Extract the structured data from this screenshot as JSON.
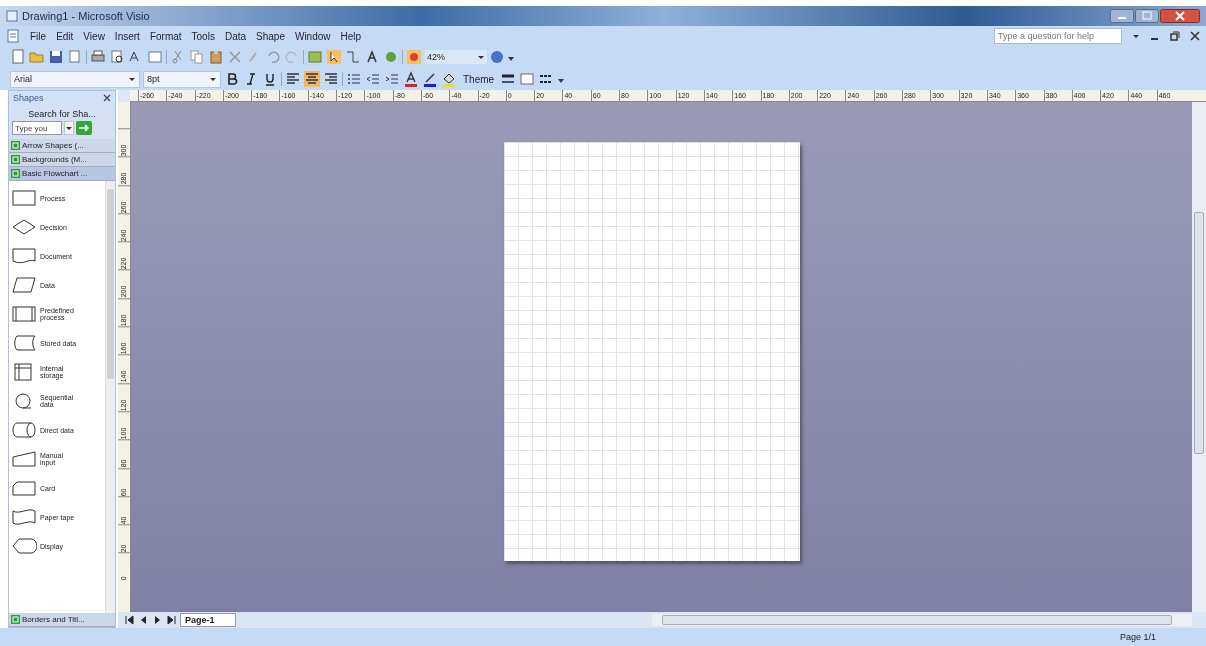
{
  "window": {
    "title": "Drawing1 - Microsoft Visio"
  },
  "menu": [
    "File",
    "Edit",
    "View",
    "Insert",
    "Format",
    "Tools",
    "Data",
    "Shape",
    "Window",
    "Help"
  ],
  "help_box": {
    "placeholder": "Type a question for help"
  },
  "toolbar": {
    "zoom": "42%"
  },
  "formatting": {
    "font": "Arial",
    "size": "8pt",
    "theme": "Theme",
    "bold": false,
    "italic": false,
    "underline": false,
    "align_left": false,
    "align_center": true,
    "align_right": false
  },
  "shapes_panel": {
    "title": "Shapes",
    "search_label": "Search for Sha...",
    "search": {
      "placeholder": "Type you"
    },
    "stencils_top": [
      {
        "label": "Arrow Shapes (..."
      },
      {
        "label": "Backgrounds (M..."
      },
      {
        "label": "Basic Flowchart ...",
        "selected": true
      }
    ],
    "shapes": [
      {
        "kind": "process",
        "label": "Process"
      },
      {
        "kind": "decision",
        "label": "Decision"
      },
      {
        "kind": "document",
        "label": "Document"
      },
      {
        "kind": "data",
        "label": "Data"
      },
      {
        "kind": "predefined",
        "label": "Predefined process"
      },
      {
        "kind": "stored",
        "label": "Stored data"
      },
      {
        "kind": "internal",
        "label": "Internal storage"
      },
      {
        "kind": "sequential",
        "label": "Sequential data"
      },
      {
        "kind": "direct",
        "label": "Direct data"
      },
      {
        "kind": "manual",
        "label": "Manual input"
      },
      {
        "kind": "card",
        "label": "Card"
      },
      {
        "kind": "tape",
        "label": "Paper tape"
      },
      {
        "kind": "display",
        "label": "Display"
      }
    ],
    "stencils_bottom": [
      {
        "label": "Borders and Titl..."
      }
    ]
  },
  "ruler_h": [
    "-260",
    "-240",
    "-220",
    "-200",
    "-180",
    "-160",
    "-140",
    "-120",
    "-100",
    "-80",
    "-60",
    "-40",
    "-20",
    "0",
    "20",
    "40",
    "60",
    "80",
    "100",
    "120",
    "140",
    "160",
    "180",
    "200",
    "220",
    "240",
    "260",
    "280",
    "300",
    "320",
    "340",
    "360",
    "380",
    "400",
    "420",
    "440",
    "460"
  ],
  "ruler_v": [
    "300",
    "280",
    "260",
    "240",
    "220",
    "200",
    "180",
    "160",
    "140",
    "120",
    "100",
    "80",
    "60",
    "40",
    "20",
    "0"
  ],
  "page_tabs": [
    {
      "label": "Page-1",
      "selected": true
    }
  ],
  "status_bar": {
    "page": "Page 1/1"
  }
}
